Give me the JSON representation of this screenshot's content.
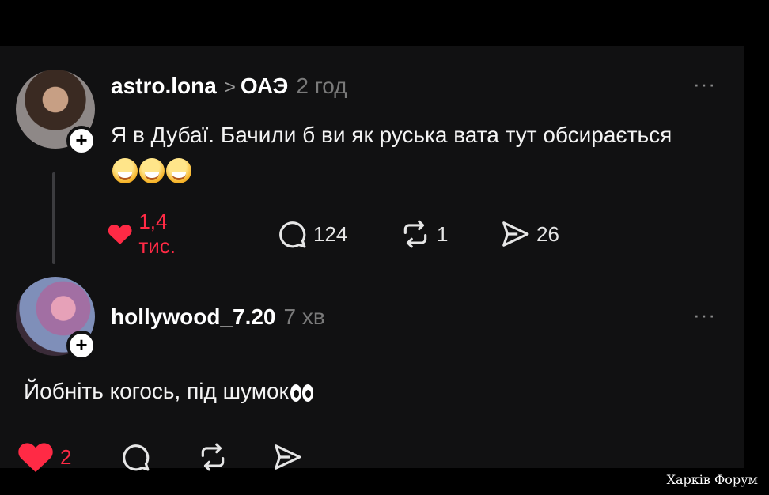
{
  "post": {
    "username": "astro.lona",
    "location_chevron": ">",
    "location": "ОАЭ",
    "time": "2 год",
    "text": "Я в Дубаї. Бачили б ви як руська вата тут обсирається",
    "likes": "1,4 тис.",
    "comments": "124",
    "reposts": "1",
    "shares": "26",
    "more": "···"
  },
  "reply": {
    "username": "hollywood_7.20",
    "time": "7 хв",
    "text": "Йобніть когось, під шумок",
    "likes": "2",
    "more": "···"
  },
  "colors": {
    "like": "#ff2a45",
    "background": "#111112"
  },
  "watermark": "Харків Форум"
}
